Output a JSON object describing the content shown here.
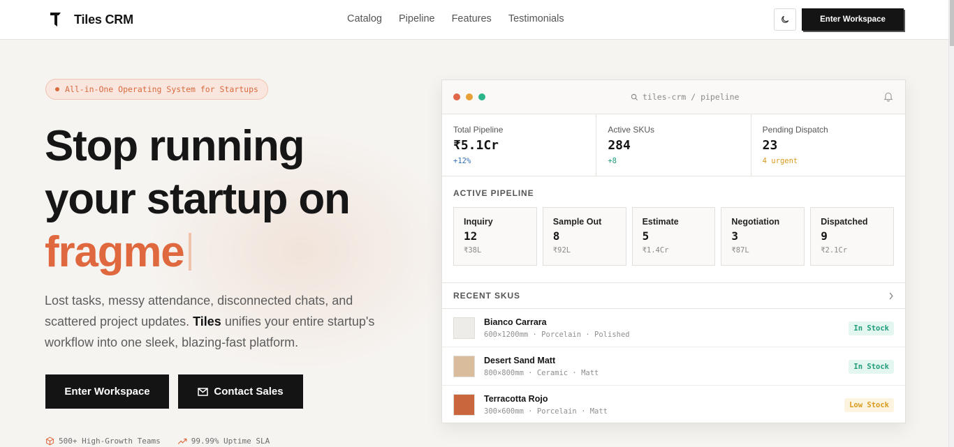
{
  "nav": {
    "brand": "Tiles CRM",
    "links": [
      "Catalog",
      "Pipeline",
      "Features",
      "Testimonials"
    ],
    "cta": "Enter Workspace",
    "theme_icon": "moon-icon"
  },
  "hero": {
    "badge": "All-in-One Operating System for Startups",
    "headline_line1": "Stop running",
    "headline_line2": "your startup on",
    "headline_accent": "fragme",
    "lead_part1": "Lost tasks, messy attendance, disconnected chats, and scattered project updates. ",
    "lead_brand": "Tiles",
    "lead_part2": " unifies your entire startup's workflow into one sleek, blazing-fast platform.",
    "primary_cta": "Enter Workspace",
    "secondary_cta": "Contact Sales",
    "stats": [
      "500+ High-Growth Teams",
      "99.99% Uptime SLA"
    ]
  },
  "dashboard": {
    "search": "tiles-crm / pipeline",
    "metrics": [
      {
        "label": "Total Pipeline",
        "value": "₹5.1Cr",
        "delta": "+12%",
        "color": "#2e6fb3"
      },
      {
        "label": "Active SKUs",
        "value": "284",
        "delta": "+8",
        "color": "#1f9c7a"
      },
      {
        "label": "Pending Dispatch",
        "value": "23",
        "delta": "4 urgent",
        "color": "#d99a1c"
      }
    ],
    "pipeline_title": "Active Pipeline",
    "stages": [
      {
        "name": "Inquiry",
        "count": "12",
        "value": "₹38L"
      },
      {
        "name": "Sample Out",
        "count": "8",
        "value": "₹92L"
      },
      {
        "name": "Estimate",
        "count": "5",
        "value": "₹1.4Cr"
      },
      {
        "name": "Negotiation",
        "count": "3",
        "value": "₹87L"
      },
      {
        "name": "Dispatched",
        "count": "9",
        "value": "₹2.1Cr"
      }
    ],
    "skus_title": "Recent SKUs",
    "skus": [
      {
        "name": "Bianco Carrara",
        "spec": "600×1200mm · Porcelain · Polished",
        "status": "In Stock",
        "swatch": "#eeece8",
        "status_color": "#1f9c7a",
        "status_bg": "#e3f6ef"
      },
      {
        "name": "Desert Sand Matt",
        "spec": "800×800mm · Ceramic · Matt",
        "status": "In Stock",
        "swatch": "#d9bc9c",
        "status_color": "#1f9c7a",
        "status_bg": "#e3f6ef"
      },
      {
        "name": "Terracotta Rojo",
        "spec": "300×600mm · Porcelain · Matt",
        "status": "Low Stock",
        "swatch": "#c9663e",
        "status_color": "#d99a1c",
        "status_bg": "#fdf4e0"
      }
    ]
  },
  "colors": {
    "accent": "#e0683e",
    "dark": "#141414",
    "light_red": "#e0664a",
    "light_amber": "#e8a137",
    "light_green": "#2bb48a"
  }
}
